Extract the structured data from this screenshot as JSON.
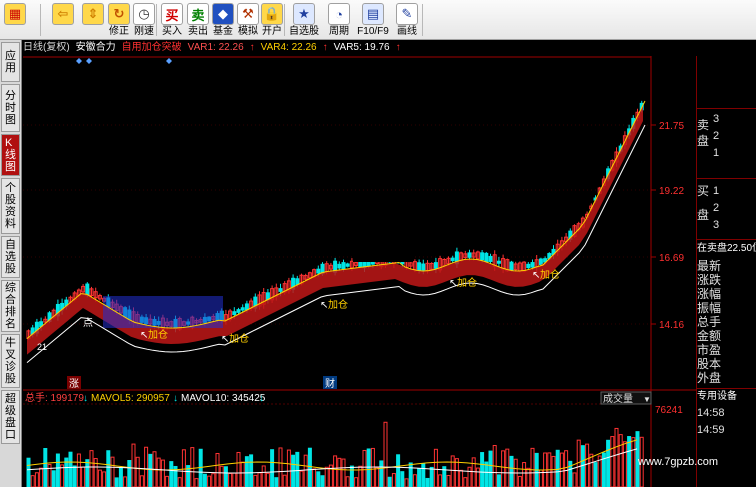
{
  "toolbar": {
    "buttons": [
      {
        "label": "",
        "icon": "menu-grid-icon"
      },
      {
        "label": "",
        "icon": "back-arrow-icon"
      },
      {
        "label": "",
        "icon": "up-down-arrows-icon"
      },
      {
        "label": "修正",
        "icon": "correction-icon"
      },
      {
        "label": "刚速",
        "icon": "clock-icon"
      },
      {
        "label": "买入",
        "icon": "buy-icon",
        "glyph": "买"
      },
      {
        "label": "卖出",
        "icon": "sell-icon",
        "glyph": "卖"
      },
      {
        "label": "基金",
        "icon": "fund-icon"
      },
      {
        "label": "模拟",
        "icon": "hammer-icon"
      },
      {
        "label": "开户",
        "icon": "lock-icon"
      },
      {
        "label": "自选股",
        "icon": "star-folder-icon"
      },
      {
        "label": "周期",
        "icon": "period-icon"
      },
      {
        "label": "F10/F9",
        "icon": "f10-icon"
      },
      {
        "label": "画线",
        "icon": "pencil-icon"
      }
    ]
  },
  "left_tabs": [
    {
      "label": "应用",
      "active": false
    },
    {
      "label": "分时图",
      "active": false
    },
    {
      "label": "K线图",
      "active": true
    },
    {
      "label": "个股资料",
      "active": false
    },
    {
      "label": "自选股",
      "active": false
    },
    {
      "label": "综合排名",
      "active": false
    },
    {
      "label": "牛叉诊股",
      "active": false
    },
    {
      "label": "超级盘口",
      "active": false
    }
  ],
  "info_line": {
    "period": "日线(复权)",
    "indicator": "安徽合力",
    "formula": "自用加仓突破",
    "var1": "VAR1: 22.26",
    "var4": "VAR4: 22.26",
    "var5": "VAR5: 19.76"
  },
  "price_axis": [
    "21.75",
    "19.22",
    "16.69",
    "14.16"
  ],
  "chart_labels": {
    "add_position": "加仓",
    "limit_up_marker": "涨",
    "finance_marker": "财",
    "price_marker": "21",
    "point_label": "点"
  },
  "volume_panel": {
    "total": "总手: 199179",
    "mavol5": "MAVOL5: 290957",
    "mavol10": "MAVOL10: 345425",
    "dropdown": "成交量",
    "max_value": "76241"
  },
  "right_panel": {
    "sell_label": "卖\n盘",
    "sell_values": [
      "3",
      "2",
      "1"
    ],
    "buy_label": "买\n盘",
    "buy_values": [
      "1",
      "2",
      "3"
    ],
    "bid_line": "在卖盘22.50位",
    "fields": [
      "最新",
      "涨跌",
      "涨幅",
      "振幅",
      "总手",
      "金额",
      "市盈",
      "股本",
      "外盘"
    ],
    "device": "专用设备",
    "times": [
      "14:58",
      "14:59"
    ]
  },
  "watermark": "www.7gpzb.com",
  "colors": {
    "up": "#ff3333",
    "down": "#00e5e5",
    "ribbon": "#c01818",
    "ribbon_fill_down": "#2030d0",
    "ma_white": "#ffffff",
    "ma_yellow": "#ffd000",
    "axis": "#a00000"
  }
}
